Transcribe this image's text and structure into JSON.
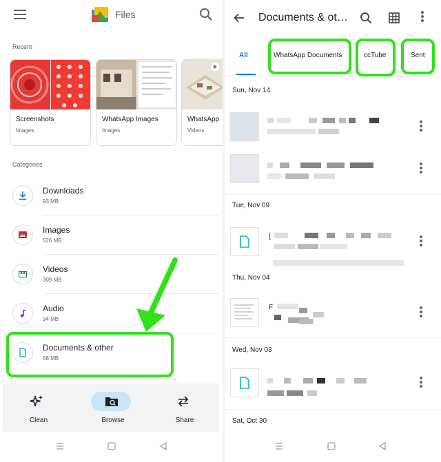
{
  "left": {
    "app_title": "Files",
    "recent_label": "Recent",
    "recent": [
      {
        "title": "Screenshots",
        "subtitle": "Images"
      },
      {
        "title": "WhatsApp Images",
        "subtitle": "Images"
      },
      {
        "title": "WhatsApp",
        "subtitle": "Videos"
      }
    ],
    "categories_label": "Categories",
    "categories": [
      {
        "title": "Downloads",
        "size": "93 MB",
        "icon": "download-icon"
      },
      {
        "title": "Images",
        "size": "526 MB",
        "icon": "image-icon"
      },
      {
        "title": "Videos",
        "size": "309 MB",
        "icon": "video-icon"
      },
      {
        "title": "Audio",
        "size": "94 MB",
        "icon": "music-note-icon"
      },
      {
        "title": "Documents & other",
        "size": "58 MB",
        "icon": "document-icon"
      }
    ],
    "nav": [
      {
        "label": "Clean",
        "icon": "sparkle-icon"
      },
      {
        "label": "Browse",
        "icon": "browse-icon",
        "active": true
      },
      {
        "label": "Share",
        "icon": "swap-arrows-icon"
      }
    ]
  },
  "right": {
    "title": "Documents & ot…",
    "tabs": [
      "All",
      "WhatsApp Documents",
      "ccTube",
      "Sent"
    ],
    "groups": [
      {
        "date": "Sun, Nov 14"
      },
      {
        "date": "Tue, Nov 09"
      },
      {
        "date": "Thu, Nov 04"
      },
      {
        "date": "Wed, Nov 03"
      },
      {
        "date": "Sat, Oct 30"
      }
    ],
    "file_prefixes": [
      "[",
      "F"
    ]
  },
  "colors": {
    "accent": "#1a73e8",
    "highlight": "#2fe21a",
    "download_blue": "#1a73e8",
    "image_red": "#d93025",
    "video_green": "#188038",
    "audio_purple": "#9334e6",
    "doc_teal": "#12b5cb"
  }
}
